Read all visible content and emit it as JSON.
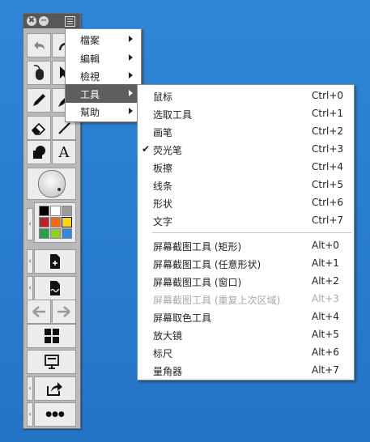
{
  "toolbox": {
    "close_glyph": "✖",
    "minimize_glyph": "−",
    "text_tool_glyph": "A",
    "more_glyph": "●●●",
    "palette_colors": [
      "#000000",
      "#ffffff",
      "#9b9b9b",
      "#c02020",
      "#ff6a00",
      "#ffd800",
      "#22a34a",
      "#8fd11f",
      "#2d8be5"
    ]
  },
  "menu": {
    "items": [
      {
        "label": "檔案"
      },
      {
        "label": "編輯"
      },
      {
        "label": "檢視"
      },
      {
        "label": "工具"
      },
      {
        "label": "幫助"
      }
    ]
  },
  "submenu": {
    "checkmark": "✔",
    "items": [
      {
        "label": "鼠标",
        "shortcut": "Ctrl+0"
      },
      {
        "label": "选取工具",
        "shortcut": "Ctrl+1"
      },
      {
        "label": "画笔",
        "shortcut": "Ctrl+2"
      },
      {
        "label": "荧光笔",
        "shortcut": "Ctrl+3"
      },
      {
        "label": "板擦",
        "shortcut": "Ctrl+4"
      },
      {
        "label": "线条",
        "shortcut": "Ctrl+5"
      },
      {
        "label": "形状",
        "shortcut": "Ctrl+6"
      },
      {
        "label": "文字",
        "shortcut": "Ctrl+7"
      },
      {
        "label": "屏幕截图工具 (矩形)",
        "shortcut": "Alt+0"
      },
      {
        "label": "屏幕截图工具 (任意形状)",
        "shortcut": "Alt+1"
      },
      {
        "label": "屏幕截图工具 (窗口)",
        "shortcut": "Alt+2"
      },
      {
        "label": "屏幕截图工具 (重复上次区域)",
        "shortcut": "Alt+3"
      },
      {
        "label": "屏幕取色工具",
        "shortcut": "Alt+4"
      },
      {
        "label": "放大镜",
        "shortcut": "Alt+5"
      },
      {
        "label": "标尺",
        "shortcut": "Alt+6"
      },
      {
        "label": "量角器",
        "shortcut": "Alt+7"
      }
    ]
  }
}
